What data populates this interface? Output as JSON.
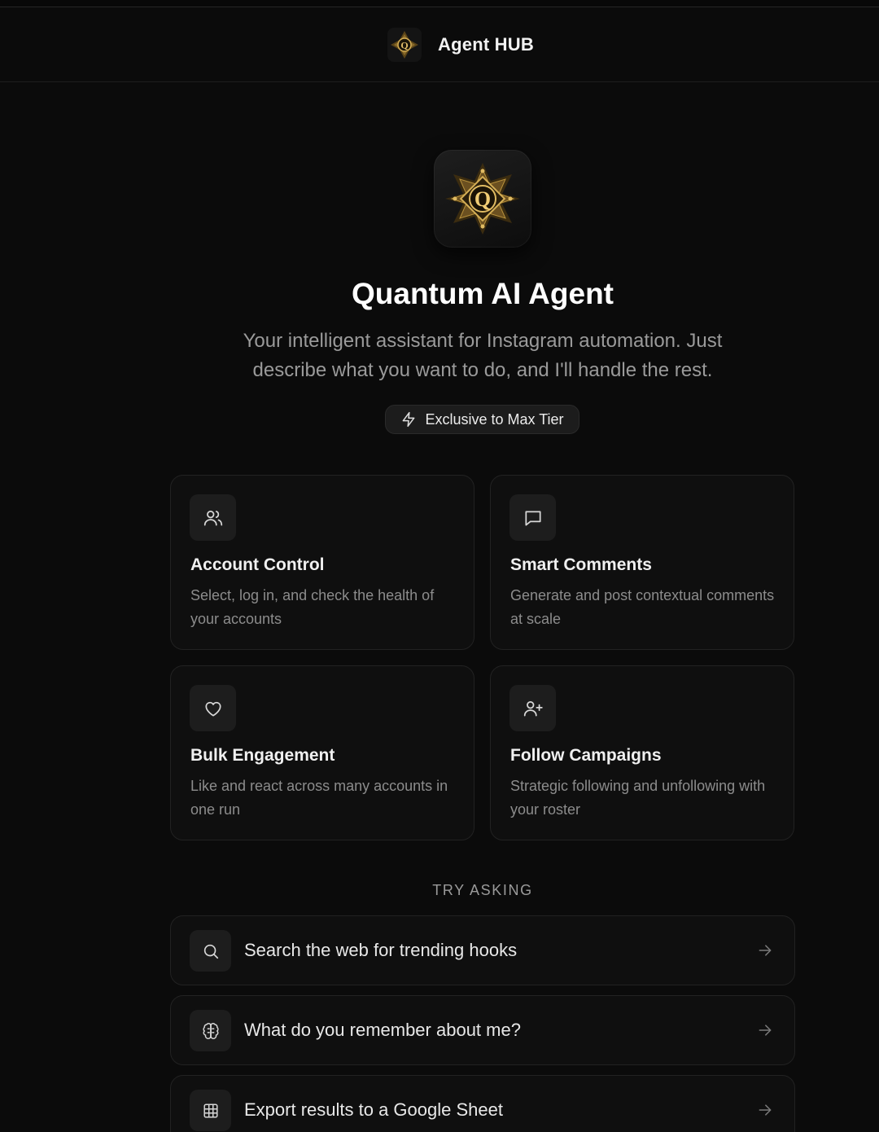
{
  "header": {
    "title": "Agent HUB",
    "logo": "quantum-q-emblem-icon"
  },
  "hero": {
    "logo": "quantum-q-emblem-icon",
    "title": "Quantum AI Agent",
    "subtitle": "Your intelligent assistant for Instagram automation. Just describe what you want to do, and I'll handle the rest.",
    "badge": "Exclusive to Max Tier"
  },
  "features": [
    {
      "icon": "users-icon",
      "title": "Account Control",
      "desc": "Select, log in, and check the health of your accounts"
    },
    {
      "icon": "message-square-icon",
      "title": "Smart Comments",
      "desc": "Generate and post contextual comments at scale"
    },
    {
      "icon": "heart-icon",
      "title": "Bulk Engagement",
      "desc": "Like and react across many accounts in one run"
    },
    {
      "icon": "user-plus-icon",
      "title": "Follow Campaigns",
      "desc": "Strategic following and unfollowing with your roster"
    }
  ],
  "try_asking": {
    "label": "TRY ASKING",
    "items": [
      {
        "icon": "search-icon",
        "text": "Search the web for trending hooks"
      },
      {
        "icon": "brain-icon",
        "text": "What do you remember about me?"
      },
      {
        "icon": "table-icon",
        "text": "Export results to a Google Sheet"
      }
    ]
  },
  "colors": {
    "background": "#0b0b0b",
    "card": "#0f0f0f",
    "gold": "#c9a24a"
  }
}
